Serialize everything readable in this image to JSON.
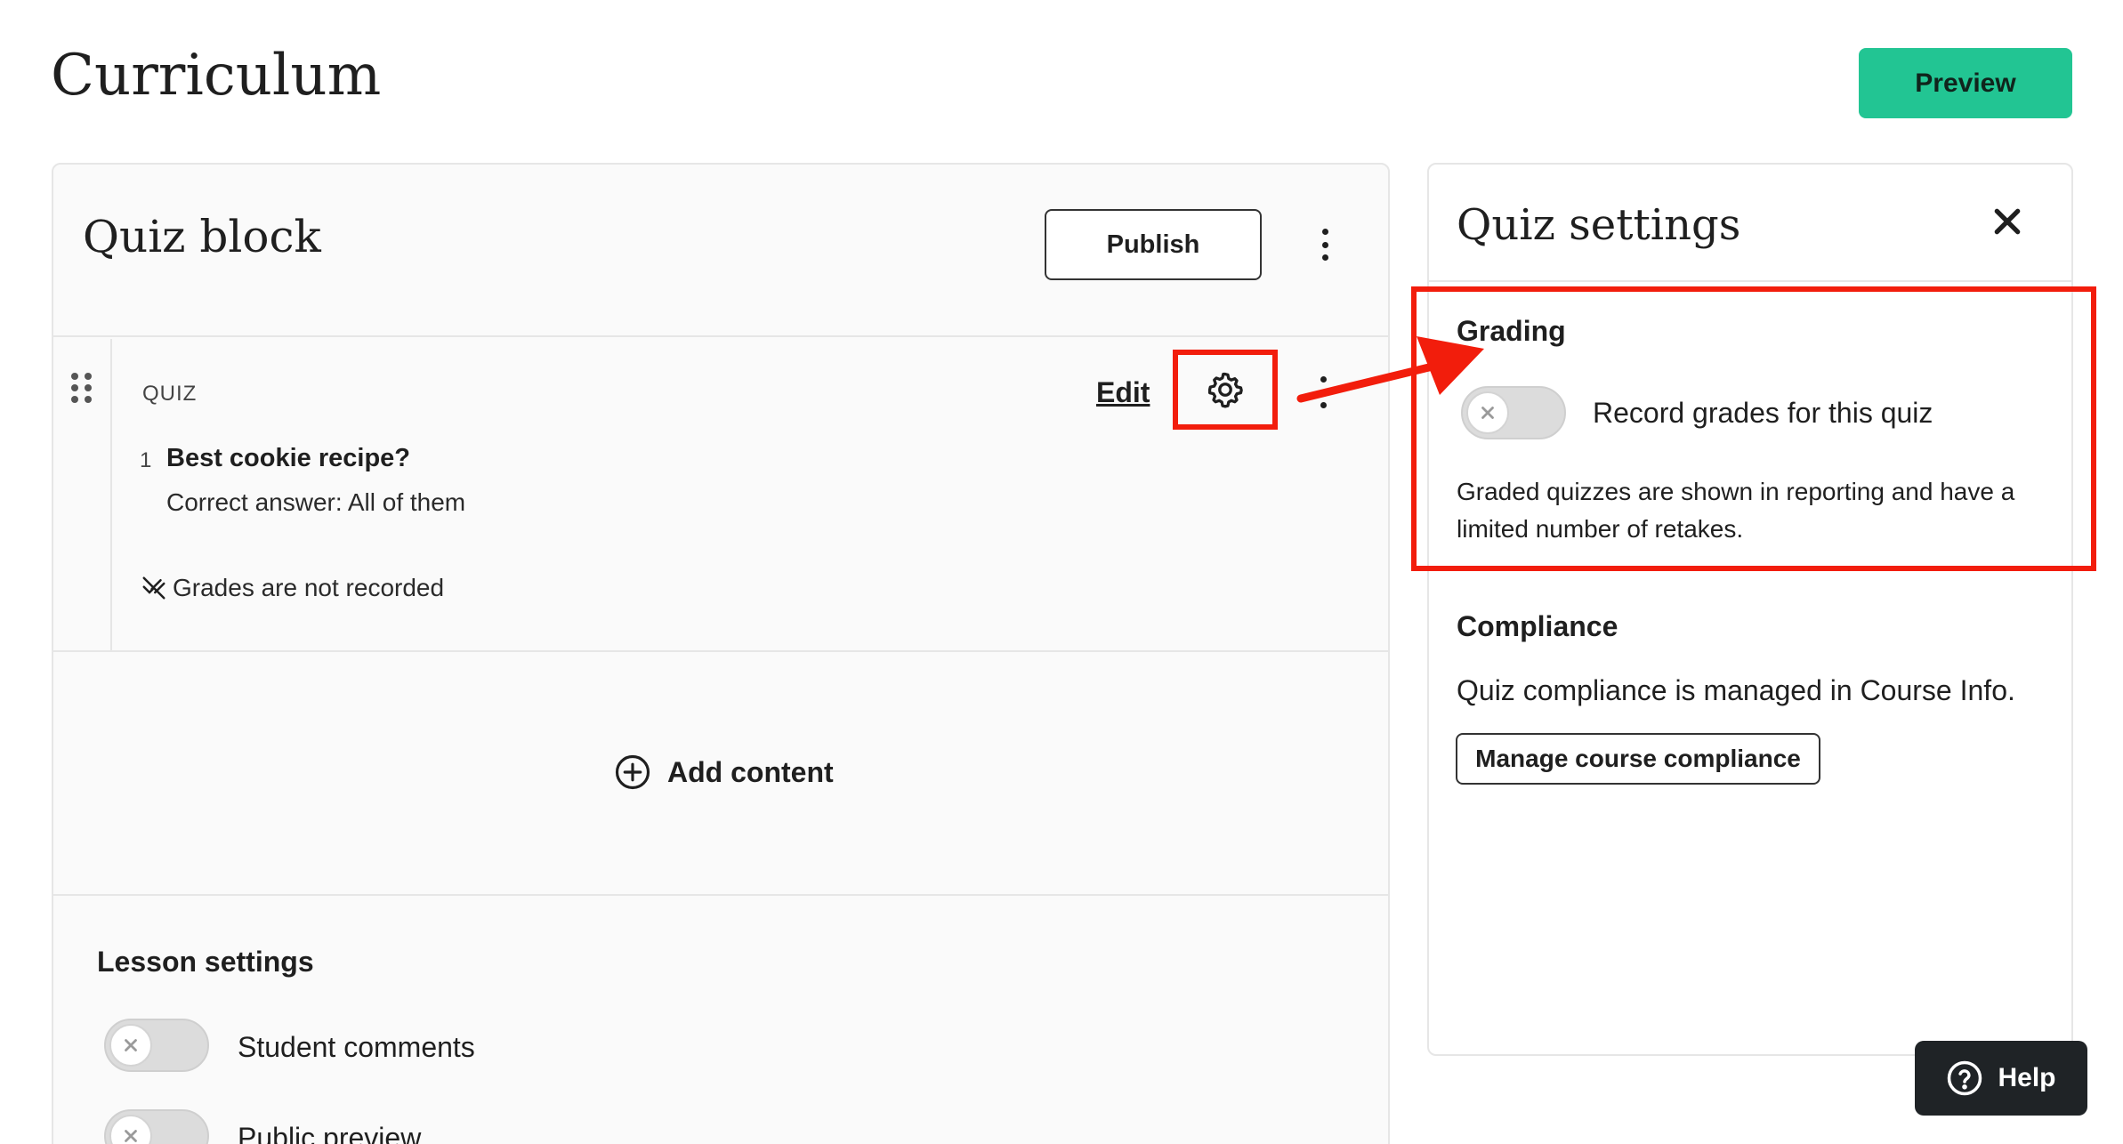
{
  "header": {
    "title": "Curriculum",
    "preview_label": "Preview"
  },
  "block": {
    "title": "Quiz block",
    "publish_label": "Publish",
    "quiz": {
      "type_label": "QUIZ",
      "edit_label": "Edit",
      "question_number": "1",
      "question_title": "Best cookie recipe?",
      "correct_answer": "Correct answer: All of them",
      "grades_note": "Grades are not recorded"
    },
    "add_content_label": "Add content"
  },
  "lesson_settings": {
    "title": "Lesson settings",
    "items": [
      {
        "label": "Student comments",
        "enabled": false
      },
      {
        "label": "Public preview",
        "enabled": false
      }
    ]
  },
  "quiz_settings": {
    "title": "Quiz settings",
    "grading": {
      "title": "Grading",
      "toggle_label": "Record grades for this quiz",
      "toggle_enabled": false,
      "description": "Graded quizzes are shown in reporting and have a limited number of retakes."
    },
    "compliance": {
      "title": "Compliance",
      "text": "Quiz compliance is managed in Course Info.",
      "button_label": "Manage course compliance"
    }
  },
  "help": {
    "label": "Help"
  },
  "colors": {
    "accent_green": "#22c593",
    "highlight_red": "#f21d0c",
    "help_bg": "#1f2326"
  },
  "icons": [
    "drag-handle-icon",
    "gear-icon",
    "kebab-icon",
    "close-icon",
    "plus-circle-icon",
    "grades-off-icon",
    "question-circle-icon",
    "toggle-x-icon"
  ]
}
